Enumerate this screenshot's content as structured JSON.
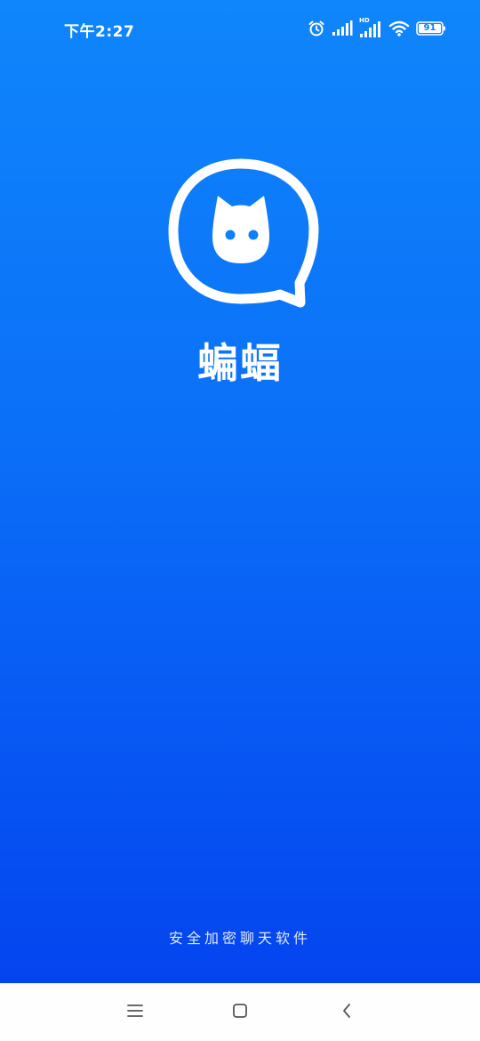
{
  "status_bar": {
    "time": "下午2:27",
    "network_label": "HD",
    "battery_level": "91",
    "icons": [
      "alarm-icon",
      "signal-icon",
      "signal-hd-icon",
      "wifi-icon",
      "battery-icon"
    ]
  },
  "splash": {
    "app_name": "蝙蝠",
    "tagline": "安全加密聊天软件",
    "background_colors": [
      "#0f86fb",
      "#0444ef"
    ]
  },
  "nav_bar": {
    "buttons": [
      "menu-icon",
      "home-icon",
      "back-icon"
    ]
  }
}
